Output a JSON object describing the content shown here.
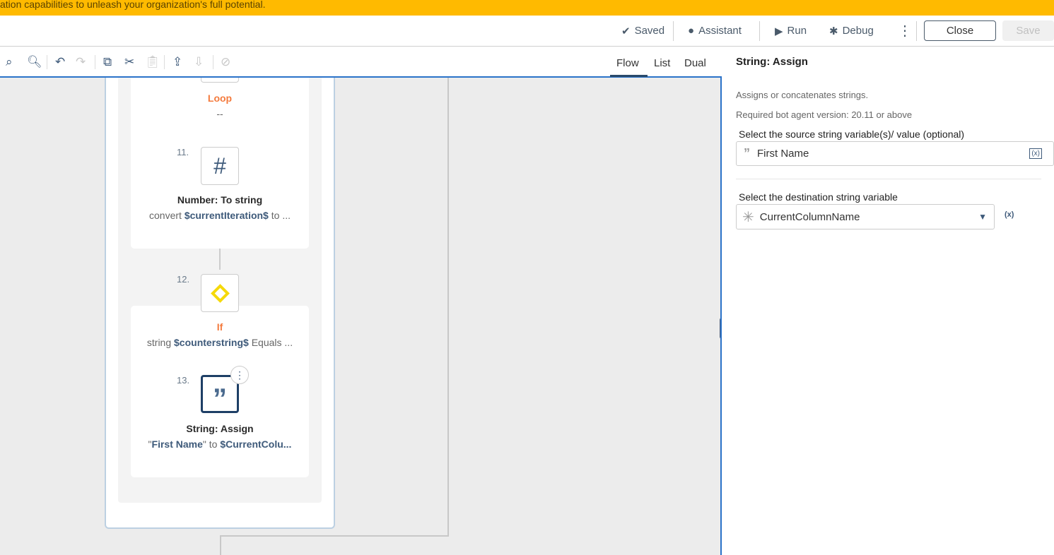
{
  "banner": {
    "text": "ation capabilities to unleash your organization's full potential."
  },
  "header": {
    "saved": "Saved",
    "assistant": "Assistant",
    "run": "Run",
    "debug": "Debug",
    "close": "Close",
    "save": "Save"
  },
  "view_tabs": [
    "Flow",
    "List",
    "Dual"
  ],
  "active_view": "Flow",
  "flow": {
    "loop": {
      "title": "Loop",
      "desc": "--"
    },
    "steps": [
      {
        "num": "11.",
        "title": "Number: To string",
        "desc_pre": "convert ",
        "desc_var": "$currentIteration$",
        "desc_post": " to ..."
      },
      {
        "num": "12.",
        "title": "If",
        "desc_pre": "string ",
        "desc_var": "$counterstring$",
        "desc_post": " Equals ..."
      },
      {
        "num": "13.",
        "title": "String: Assign",
        "desc_pre": "\"",
        "desc_var": "First Name",
        "desc_mid": "\" to ",
        "desc_var2": "$CurrentColu..."
      }
    ]
  },
  "panel": {
    "title": "String: Assign",
    "description": "Assigns or concatenates strings.",
    "version": "Required bot agent version: 20.11 or above",
    "source_label": "Select the source string variable(s)/ value (optional)",
    "source_value": "First Name",
    "dest_label": "Select the destination string variable",
    "dest_value": "CurrentColumnName",
    "var_btn": "(x)"
  }
}
